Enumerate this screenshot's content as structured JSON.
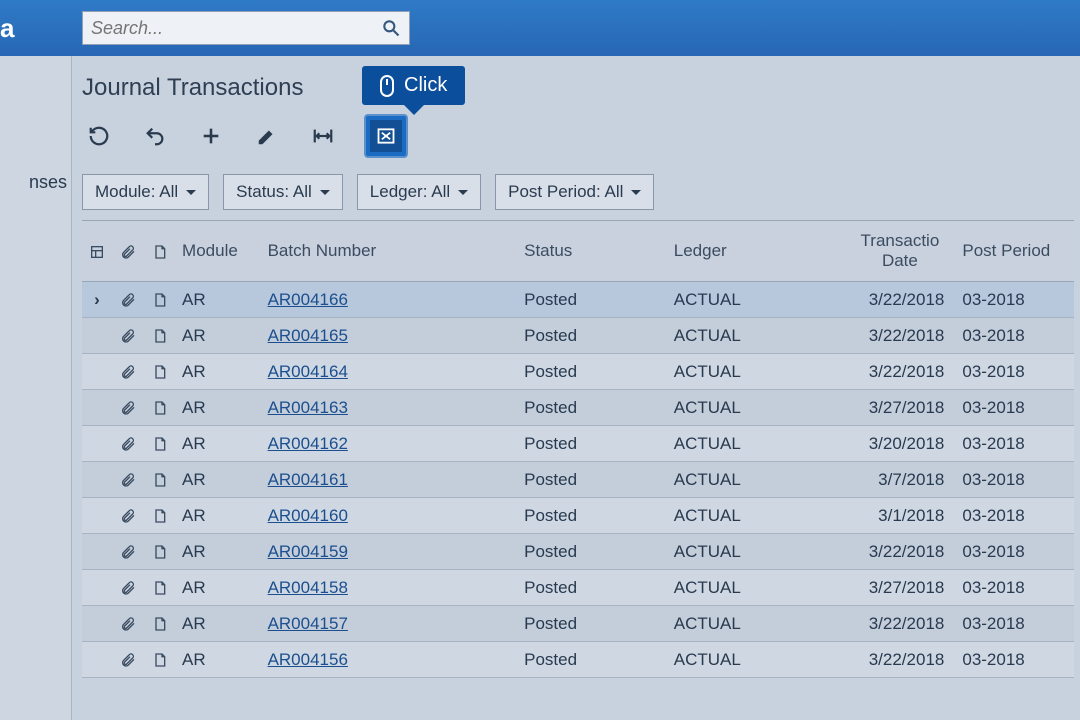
{
  "search": {
    "placeholder": "Search..."
  },
  "sidebar": {
    "item0": "nses"
  },
  "page": {
    "title": "Journal Transactions"
  },
  "tooltip": {
    "label": "Click"
  },
  "filters": {
    "module": "Module: All",
    "status": "Status: All",
    "ledger": "Ledger: All",
    "post_period": "Post Period: All"
  },
  "columns": {
    "module": "Module",
    "batch": "Batch Number",
    "status": "Status",
    "ledger": "Ledger",
    "date_l1": "Transactio",
    "date_l2": "Date",
    "period": "Post Period"
  },
  "rows": [
    {
      "module": "AR",
      "batch": "AR004166",
      "status": "Posted",
      "ledger": "ACTUAL",
      "date": "3/22/2018",
      "period": "03-2018",
      "selected": true
    },
    {
      "module": "AR",
      "batch": "AR004165",
      "status": "Posted",
      "ledger": "ACTUAL",
      "date": "3/22/2018",
      "period": "03-2018"
    },
    {
      "module": "AR",
      "batch": "AR004164",
      "status": "Posted",
      "ledger": "ACTUAL",
      "date": "3/22/2018",
      "period": "03-2018"
    },
    {
      "module": "AR",
      "batch": "AR004163",
      "status": "Posted",
      "ledger": "ACTUAL",
      "date": "3/27/2018",
      "period": "03-2018"
    },
    {
      "module": "AR",
      "batch": "AR004162",
      "status": "Posted",
      "ledger": "ACTUAL",
      "date": "3/20/2018",
      "period": "03-2018"
    },
    {
      "module": "AR",
      "batch": "AR004161",
      "status": "Posted",
      "ledger": "ACTUAL",
      "date": "3/7/2018",
      "period": "03-2018"
    },
    {
      "module": "AR",
      "batch": "AR004160",
      "status": "Posted",
      "ledger": "ACTUAL",
      "date": "3/1/2018",
      "period": "03-2018"
    },
    {
      "module": "AR",
      "batch": "AR004159",
      "status": "Posted",
      "ledger": "ACTUAL",
      "date": "3/22/2018",
      "period": "03-2018"
    },
    {
      "module": "AR",
      "batch": "AR004158",
      "status": "Posted",
      "ledger": "ACTUAL",
      "date": "3/27/2018",
      "period": "03-2018"
    },
    {
      "module": "AR",
      "batch": "AR004157",
      "status": "Posted",
      "ledger": "ACTUAL",
      "date": "3/22/2018",
      "period": "03-2018"
    },
    {
      "module": "AR",
      "batch": "AR004156",
      "status": "Posted",
      "ledger": "ACTUAL",
      "date": "3/22/2018",
      "period": "03-2018"
    }
  ]
}
